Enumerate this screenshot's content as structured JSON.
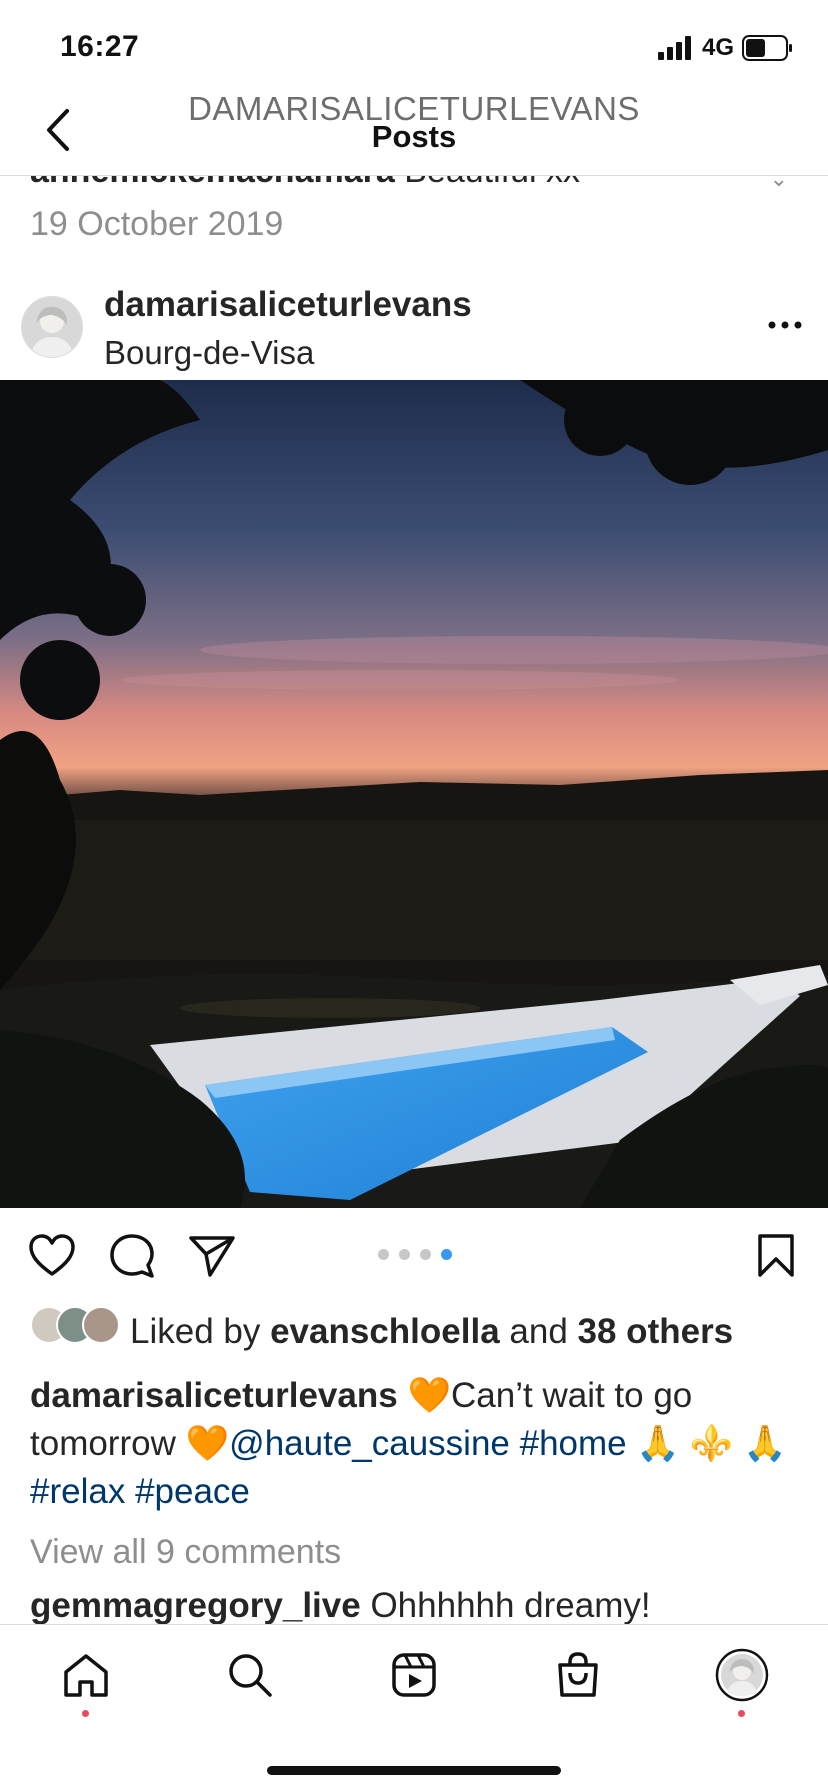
{
  "status_bar": {
    "time": "16:27",
    "network": "4G",
    "battery_level": 0.5
  },
  "header": {
    "username": "DAMARISALICETURLEVANS",
    "title": "Posts"
  },
  "previous_comment": {
    "username": "annemickemachamara",
    "text": "Beautiful xx"
  },
  "previous_post_date": "19 October 2019",
  "post": {
    "username": "damarisaliceturlevans",
    "location": "Bourg-de-Visa",
    "carousel": {
      "count": 4,
      "active_index": 3
    },
    "likes": {
      "prefix": "Liked by ",
      "first_liker": "evanschloella",
      "middle": " and ",
      "others": "38 others"
    },
    "caption": {
      "username": "damarisaliceturlevans",
      "seg1": " 🧡Can’t wait to go tomorrow 🧡",
      "mention": "@haute_caussine",
      "seg2": " ",
      "tag1": "#home",
      "seg3": " 🙏 ⚜️ 🙏",
      "tag2": "#relax",
      "seg4": " ",
      "tag3": "#peace"
    },
    "view_all_comments": "View all 9 comments",
    "comment": {
      "username": "gemmagregory_live",
      "text": " Ohhhhhh dreamy!"
    }
  },
  "icons": {
    "back": "chevron-left-icon",
    "more": "more-horizontal-icon",
    "like": "heart-icon",
    "comment": "comment-icon",
    "share": "send-icon",
    "save": "bookmark-icon"
  },
  "tab_bar": [
    "home-icon",
    "search-icon",
    "reels-icon",
    "shop-icon",
    "profile-avatar"
  ],
  "colors": {
    "link": "#00376b",
    "muted": "#8e8e8e",
    "active_dot": "#3897f0",
    "notification": "#ed4956"
  }
}
